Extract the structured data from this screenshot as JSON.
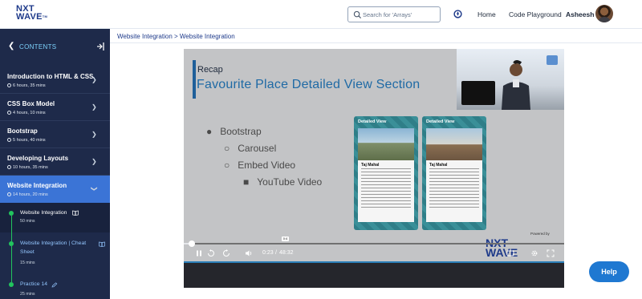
{
  "brand": {
    "logo_text_line1": "NXT",
    "logo_text_line2": "WAVE",
    "logo_tm": "TM"
  },
  "header": {
    "search_placeholder": "Search for 'Arrays'",
    "nav": {
      "home": "Home",
      "code_playground": "Code Playground"
    },
    "user_name": "Asheesh"
  },
  "sidebar": {
    "title": "CONTENTS",
    "sections": [
      {
        "title": "Introduction to HTML & CSS",
        "meta": "6 hours, 35 mins"
      },
      {
        "title": "CSS Box Model",
        "meta": "4 hours, 10 mins"
      },
      {
        "title": "Bootstrap",
        "meta": "5 hours, 40 mins"
      },
      {
        "title": "Developing Layouts",
        "meta": "10 hours, 35 mins"
      },
      {
        "title": "Website Integration",
        "meta": "14 hours, 20 mins",
        "expanded": true
      }
    ],
    "sub_items": [
      {
        "title": "Website Integration",
        "meta": "50 mins",
        "completed": true
      },
      {
        "title_line1": "Website Integration | Cheat",
        "title_line2": "Sheet",
        "meta": "15 mins",
        "completed": true
      },
      {
        "title": "Practice 14",
        "meta": "25 mins",
        "completed": true
      }
    ]
  },
  "breadcrumb": "Website Integration > Website Integration",
  "video": {
    "slide_recap": "Recap",
    "slide_heading": "Favourite Place Detailed View Section",
    "bullets": [
      "Bootstrap",
      "Carousel",
      "Embed Video",
      "YouTube Video"
    ],
    "phones": [
      {
        "header": "Detailed View",
        "place": "Taj Mahal"
      },
      {
        "header": "Detailed View",
        "place": "Taj Mahal"
      }
    ],
    "powered_by": "Powered by",
    "watermark_line1": "NXT",
    "watermark_line2": "WAVE",
    "current_time": "0:23",
    "separator": "/",
    "duration": "48:32",
    "progress_fraction": 0.008,
    "hover_tip": "0:4"
  },
  "help_label": "Help",
  "colors": {
    "sidebar_bg": "#1e2a4a",
    "sidebar_active": "#3b74d6",
    "complete_green": "#22c55e",
    "accent_blue": "#1f78d1",
    "slide_heading": "#1f6aa5"
  }
}
